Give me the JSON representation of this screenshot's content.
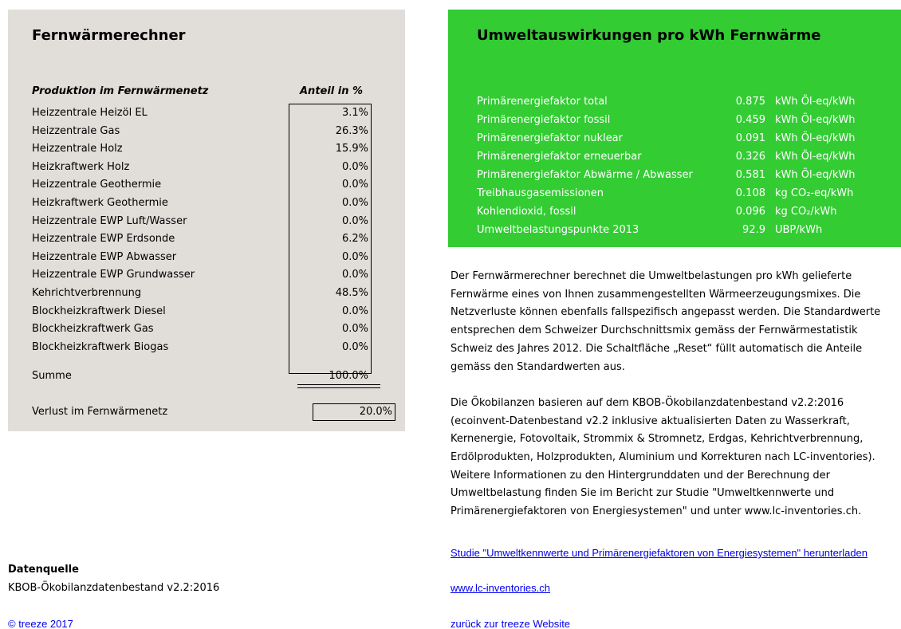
{
  "calculator": {
    "title": "Fernwärmerechner",
    "header_label": "Produktion im Fernwärmenetz",
    "header_share": "Anteil in %",
    "rows": [
      {
        "label": "Heizzentrale Heizöl EL",
        "value": "3.1%"
      },
      {
        "label": "Heizzentrale Gas",
        "value": "26.3%"
      },
      {
        "label": "Heizzentrale Holz",
        "value": "15.9%"
      },
      {
        "label": "Heizkraftwerk Holz",
        "value": "0.0%"
      },
      {
        "label": "Heizzentrale Geothermie",
        "value": "0.0%"
      },
      {
        "label": "Heizkraftwerk Geothermie",
        "value": "0.0%"
      },
      {
        "label": "Heizzentrale EWP Luft/Wasser",
        "value": "0.0%"
      },
      {
        "label": "Heizzentrale EWP Erdsonde",
        "value": "6.2%"
      },
      {
        "label": "Heizzentrale EWP Abwasser",
        "value": "0.0%"
      },
      {
        "label": "Heizzentrale EWP Grundwasser",
        "value": "0.0%"
      },
      {
        "label": "Kehrichtverbrennung",
        "value": "48.5%"
      },
      {
        "label": "Blockheizkraftwerk Diesel",
        "value": "0.0%"
      },
      {
        "label": "Blockheizkraftwerk Gas",
        "value": "0.0%"
      },
      {
        "label": "Blockheizkraftwerk Biogas",
        "value": "0.0%"
      }
    ],
    "sum_label": "Summe",
    "sum_value": "100.0%",
    "loss_label": "Verlust im Fernwärmenetz",
    "loss_value": "20.0%"
  },
  "impacts": {
    "title": "Umweltauswirkungen pro kWh Fernwärme",
    "rows": [
      {
        "label": "Primärenergiefaktor total",
        "value": "0.875",
        "unit": "kWh Öl-eq/kWh"
      },
      {
        "label": "Primärenergiefaktor fossil",
        "value": "0.459",
        "unit": "kWh Öl-eq/kWh"
      },
      {
        "label": "Primärenergiefaktor nuklear",
        "value": "0.091",
        "unit": "kWh Öl-eq/kWh"
      },
      {
        "label": "Primärenergiefaktor erneuerbar",
        "value": "0.326",
        "unit": "kWh Öl-eq/kWh"
      },
      {
        "label": "Primärenergiefaktor Abwärme / Abwasser",
        "value": "0.581",
        "unit": "kWh Öl-eq/kWh"
      },
      {
        "label": "Treibhausgasemissionen",
        "value": "0.108",
        "unit": "kg CO₂-eq/kWh"
      },
      {
        "label": "Kohlendioxid, fossil",
        "value": "0.096",
        "unit": "kg CO₂/kWh"
      },
      {
        "label": "Umweltbelastungspunkte 2013",
        "value": "92.9",
        "unit": "UBP/kWh"
      }
    ]
  },
  "description": {
    "p1": "Der Fernwärmerechner berechnet die Umweltbelastungen pro kWh gelieferte Fernwärme eines von Ihnen zusammengestellten Wärmeerzeugungsmixes. Die Netzverluste können ebenfalls fallspezifisch angepasst werden. Die Standardwerte entsprechen dem Schweizer Durchschnittsmix gemäss der Fernwärmestatistik Schweiz des Jahres 2012. Die Schaltfläche „Reset“ füllt automatisch die Anteile gemäss den Standardwerten aus.",
    "p2": "Die Ökobilanzen basieren auf dem KBOB-Ökobilanzdatenbestand v2.2:2016 (ecoinvent-Datenbestand v2.2 inklusive aktualisierten Daten zu Wasserkraft, Kernenergie, Fotovoltaik, Strommix & Stromnetz, Erdgas, Kehrichtverbrennung, Erdölprodukten, Holzprodukten, Aluminium und Korrekturen nach LC-inventories). Weitere Informationen zu den Hintergrunddaten und der Berechnung der Umweltbelastung finden Sie im Bericht zur Studie \"Umweltkennwerte und Primärenergiefaktoren von Energiesystemen\" und unter www.lc-inventories.ch."
  },
  "links": {
    "study": "Studie \"Umweltkennwerte und Primärenergiefaktoren von Energiesystemen\" herunterladen",
    "lci": "www.lc-inventories.ch",
    "back": "zurück zur treeze Website"
  },
  "source": {
    "title": "Datenquelle",
    "value": "KBOB-Ökobilanzdatenbestand v2.2:2016"
  },
  "copyright": "© treeze 2017",
  "colors": {
    "left_panel": "#e1ddd9",
    "right_panel": "#33cc33",
    "link": "#0000ee"
  }
}
